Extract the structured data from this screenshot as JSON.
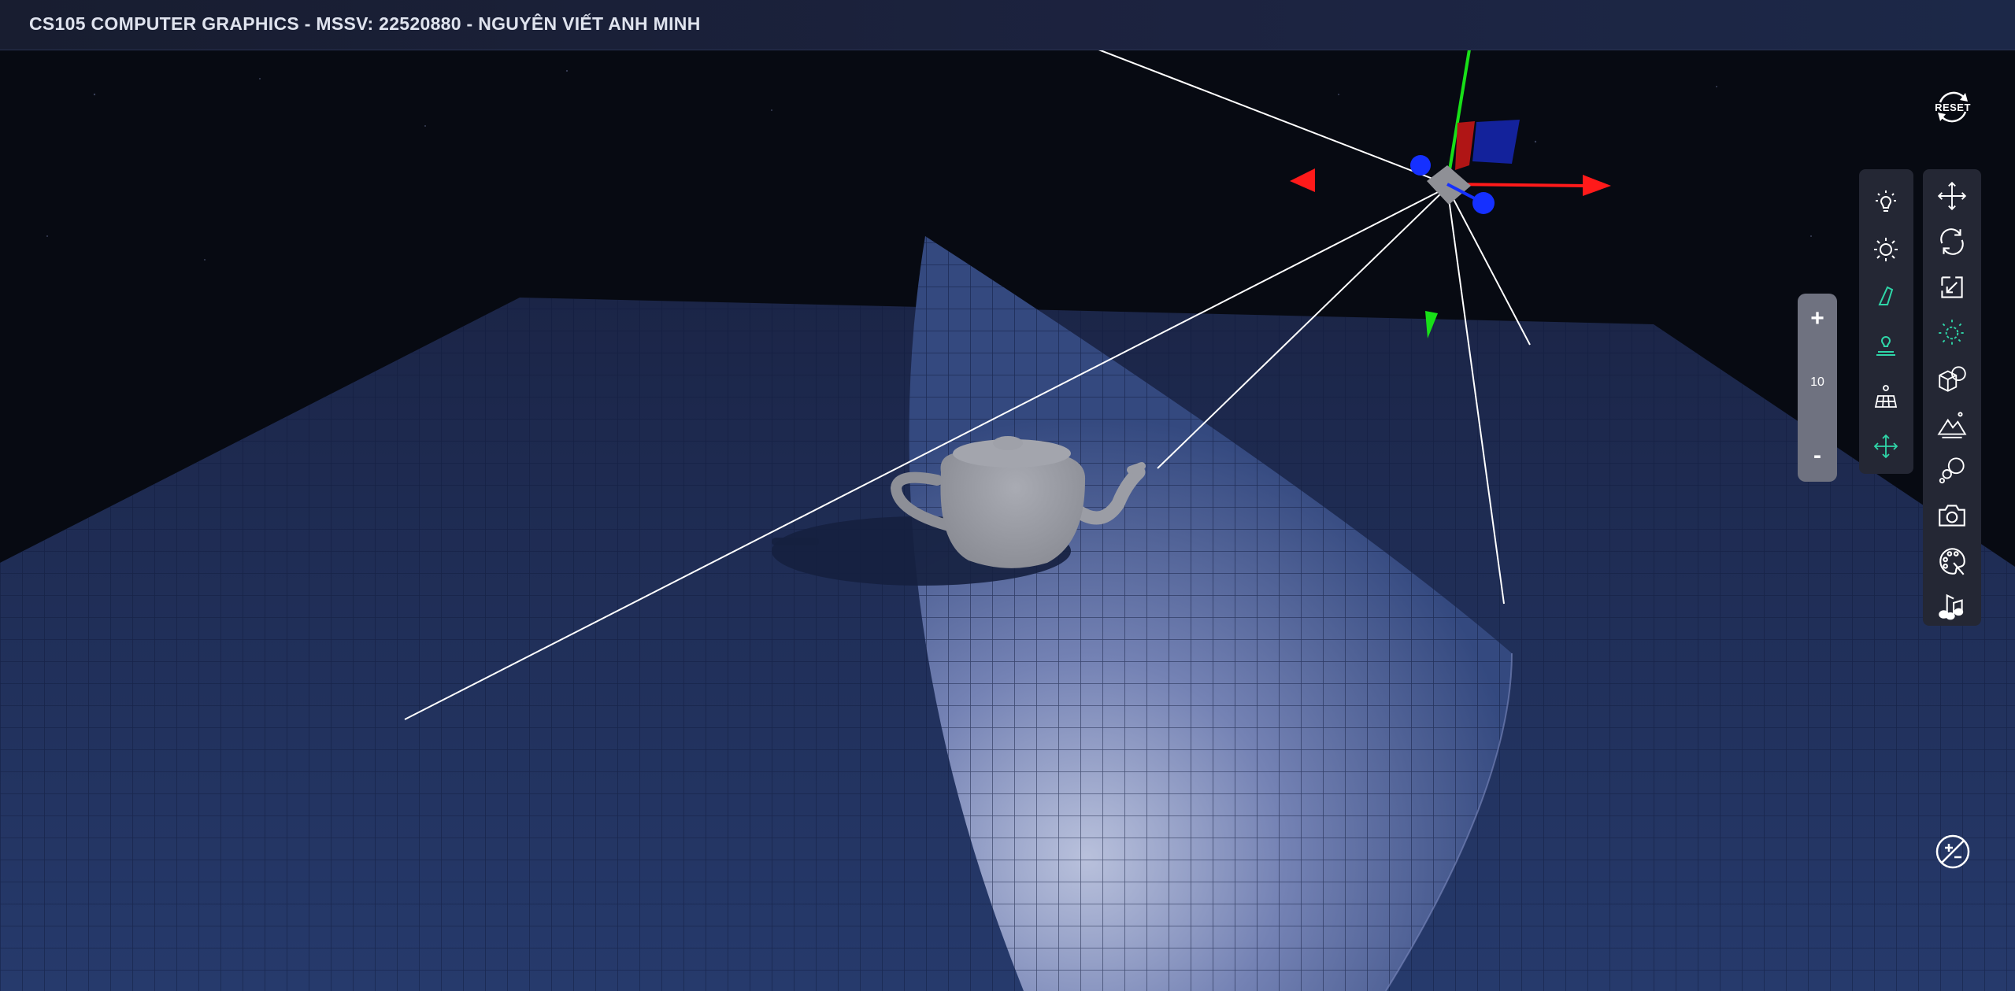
{
  "header": {
    "title": "CS105 COMPUTER GRAPHICS - MSSV: 22520880 - NGUYÊN VIẾT ANH MINH"
  },
  "controls": {
    "reset_label": "RESET",
    "zoom": {
      "plus": "+",
      "value": "10",
      "minus": "-"
    }
  },
  "light_toolbar": {
    "items": [
      {
        "icon": "lightbulb-icon",
        "active": false
      },
      {
        "icon": "sun-icon",
        "active": false
      },
      {
        "icon": "spotlight-icon",
        "active": true
      },
      {
        "icon": "point-light-icon",
        "active": true
      },
      {
        "icon": "solar-panel-icon",
        "active": false
      },
      {
        "icon": "move-light-icon",
        "active": true
      }
    ]
  },
  "main_toolbar": {
    "items": [
      {
        "icon": "translate-icon",
        "active": false
      },
      {
        "icon": "rotate-icon",
        "active": false
      },
      {
        "icon": "scale-icon",
        "active": false
      },
      {
        "icon": "light-icon",
        "active": true
      },
      {
        "icon": "shapes-icon",
        "active": false
      },
      {
        "icon": "terrain-icon",
        "active": false
      },
      {
        "icon": "animation-icon",
        "active": false
      },
      {
        "icon": "camera-icon",
        "active": false
      },
      {
        "icon": "palette-icon",
        "active": false
      },
      {
        "icon": "music-icon",
        "active": false
      }
    ]
  },
  "colors": {
    "background": "#070a12",
    "floor": "#26396a",
    "grid_line": "#0f1a3a",
    "light_ray": "#ffffff",
    "teapot": "#9a9ca4",
    "axis_x": "#ff1a1a",
    "axis_y": "#18e018",
    "axis_z": "#1530ff",
    "active_icon": "#2fd6a8",
    "inactive_icon": "#ffffff"
  }
}
